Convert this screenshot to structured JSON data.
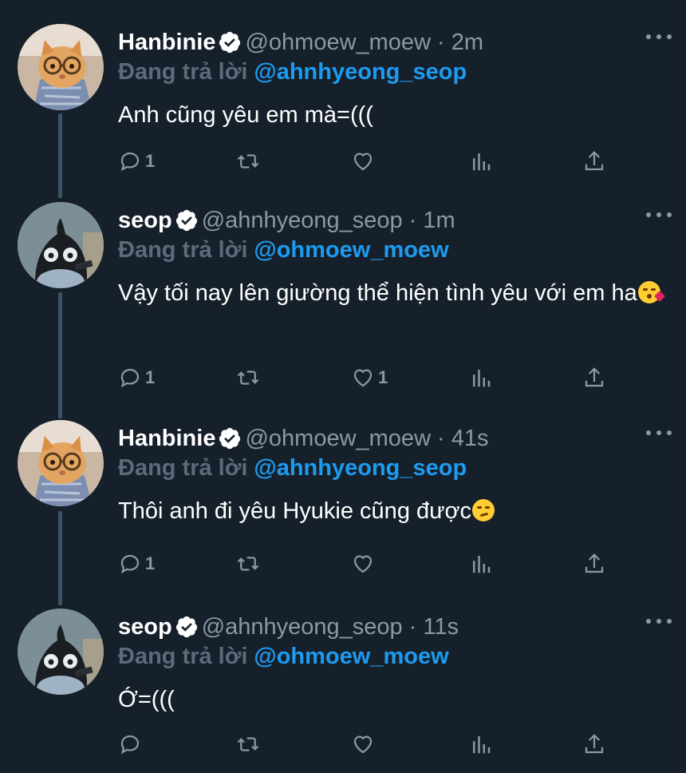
{
  "colors": {
    "background": "#15202b",
    "text": "#ffffff",
    "muted": "#8b98a5",
    "mention": "#1d9bf0",
    "thread_line": "#3d5466",
    "verified": "#ffffff"
  },
  "tweets": [
    {
      "display_name": "Hanbinie",
      "handle": "@ohmoew_moew",
      "separator": "·",
      "time": "2m",
      "reply_label": "Đang trả lời",
      "reply_to": "@ahnhyeong_seop",
      "text": "Anh cũng yêu em mà=(((",
      "emoji": "",
      "reply_count": "1",
      "retweet_count": "",
      "like_count": "",
      "avatar": "cat-with-glasses",
      "verified": "verified-badge-icon"
    },
    {
      "display_name": "seop",
      "handle": "@ahnhyeong_seop",
      "separator": "·",
      "time": "1m",
      "reply_label": "Đang trả lời",
      "reply_to": "@ohmoew_moew",
      "text": "Vậy tối nay lên giường thể hiện tình yêu với em ha",
      "emoji": "kissing-heart-emoji",
      "reply_count": "1",
      "retweet_count": "",
      "like_count": "1",
      "avatar": "dark-blob-character",
      "verified": "verified-badge-icon"
    },
    {
      "display_name": "Hanbinie",
      "handle": "@ohmoew_moew",
      "separator": "·",
      "time": "41s",
      "reply_label": "Đang trả lời",
      "reply_to": "@ahnhyeong_seop",
      "text": "Thôi anh đi yêu Hyukie cũng được",
      "emoji": "smirk-emoji",
      "reply_count": "1",
      "retweet_count": "",
      "like_count": "",
      "avatar": "cat-with-glasses",
      "verified": "verified-badge-icon"
    },
    {
      "display_name": "seop",
      "handle": "@ahnhyeong_seop",
      "separator": "·",
      "time": "11s",
      "reply_label": "Đang trả lời",
      "reply_to": "@ohmoew_moew",
      "text": "Ớ=(((",
      "emoji": "",
      "reply_count": "",
      "retweet_count": "",
      "like_count": "",
      "avatar": "dark-blob-character",
      "verified": "verified-badge-icon"
    }
  ]
}
